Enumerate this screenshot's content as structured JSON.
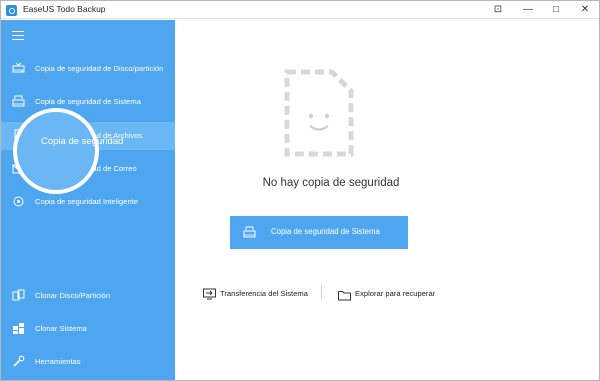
{
  "window": {
    "title": "EaseUS Todo Backup"
  },
  "titlebar": {
    "app_ctrl": "⊡",
    "min": "—",
    "max": "□",
    "close": "✕"
  },
  "sidebar": {
    "items": [
      {
        "label": "Copia de seguridad de Disco/partición",
        "icon": "disk-icon"
      },
      {
        "label": "Copia de seguridad de Sistema",
        "icon": "system-icon"
      },
      {
        "label": "Copia de seguridad de Archivos",
        "icon": "file-icon",
        "active": true
      },
      {
        "label": "Copia de seguridad de Correo",
        "icon": "mail-icon"
      },
      {
        "label": "Copia de seguridad Inteligente",
        "icon": "smart-icon"
      }
    ],
    "tools": [
      {
        "label": "Clonar Disco/Partición",
        "icon": "clone-disk-icon"
      },
      {
        "label": "Clonar Sistema",
        "icon": "clone-system-icon"
      },
      {
        "label": "Herramientas",
        "icon": "tools-icon"
      }
    ],
    "magnifier_label": "Copia de seguridad"
  },
  "main": {
    "empty_text": "No hay copia de seguridad",
    "primary_button": "Copia de seguridad de Sistema",
    "links": {
      "transfer": "Transferencia del Sistema",
      "explore": "Explorar para recuperar"
    }
  },
  "colors": {
    "sidebar": "#4ea6f0",
    "accent": "#4ea6f0",
    "active": "#6bb7f4"
  }
}
